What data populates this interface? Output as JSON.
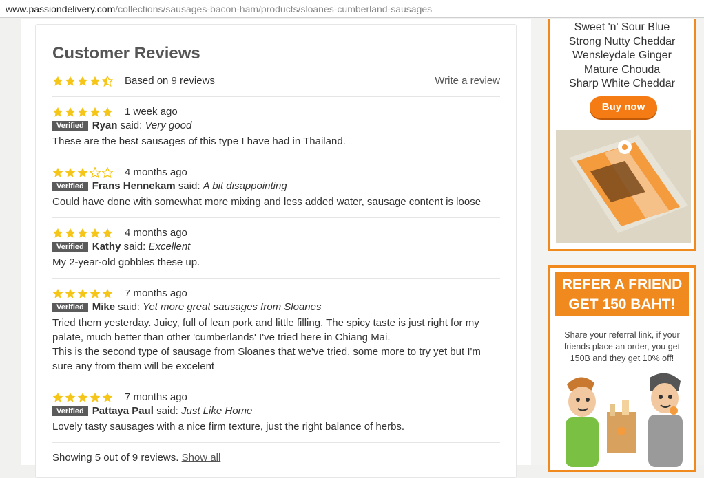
{
  "url": {
    "host": "www.passiondelivery.com",
    "path": "/collections/sausages-bacon-ham/products/sloanes-cumberland-sausages"
  },
  "reviews": {
    "heading": "Customer Reviews",
    "average_rating": 4.5,
    "based_on": "Based on 9 reviews",
    "write_link": "Write a review",
    "verified_label": "Verified",
    "said_label": "said:",
    "items": [
      {
        "rating": 5,
        "date": "1 week ago",
        "author": "Ryan",
        "title": "Very good",
        "body": [
          "These are the best sausages of this type I have had in Thailand."
        ]
      },
      {
        "rating": 3,
        "date": "4 months ago",
        "author": "Frans Hennekam",
        "title": "A bit disappointing",
        "body": [
          "Could have done with somewhat more mixing and less added water, sausage content is loose"
        ]
      },
      {
        "rating": 5,
        "date": "4 months ago",
        "author": "Kathy",
        "title": "Excellent",
        "body": [
          "My 2-year-old gobbles these up."
        ]
      },
      {
        "rating": 5,
        "date": "7 months ago",
        "author": "Mike",
        "title": "Yet more great sausages from Sloanes",
        "body": [
          "Tried them yesterday. Juicy, full of lean pork and little filling. The spicy taste is just right for my palate, much better than other 'cumberlands' I've tried here in Chiang Mai.",
          "This is the second type of sausage from Sloanes that we've tried, some more to try yet but I'm sure any from them will be excelent"
        ]
      },
      {
        "rating": 5,
        "date": "7 months ago",
        "author": "Pattaya Paul",
        "title": "Just Like Home",
        "body": [
          "Lovely tasty sausages with a nice firm texture, just the right balance of herbs."
        ]
      }
    ],
    "showing_text": "Showing 5 out of 9 reviews.",
    "show_all_link": "Show all"
  },
  "sidebar": {
    "cheeses": [
      "Sweet 'n' Sour Blue",
      "Strong Nutty Cheddar",
      "Wensleydale Ginger",
      "Mature Chouda",
      "Sharp White Cheddar"
    ],
    "buy_now": "Buy now",
    "refer_title_1": "REFER A FRIEND",
    "refer_title_2": "GET 150 BAHT!",
    "refer_text": "Share your referral link, if your friends place an order, you get 150B and they get 10% off!"
  },
  "colors": {
    "star": "#f5c518",
    "accent_orange": "#f08a1e",
    "badge": "#5b5b5b"
  }
}
